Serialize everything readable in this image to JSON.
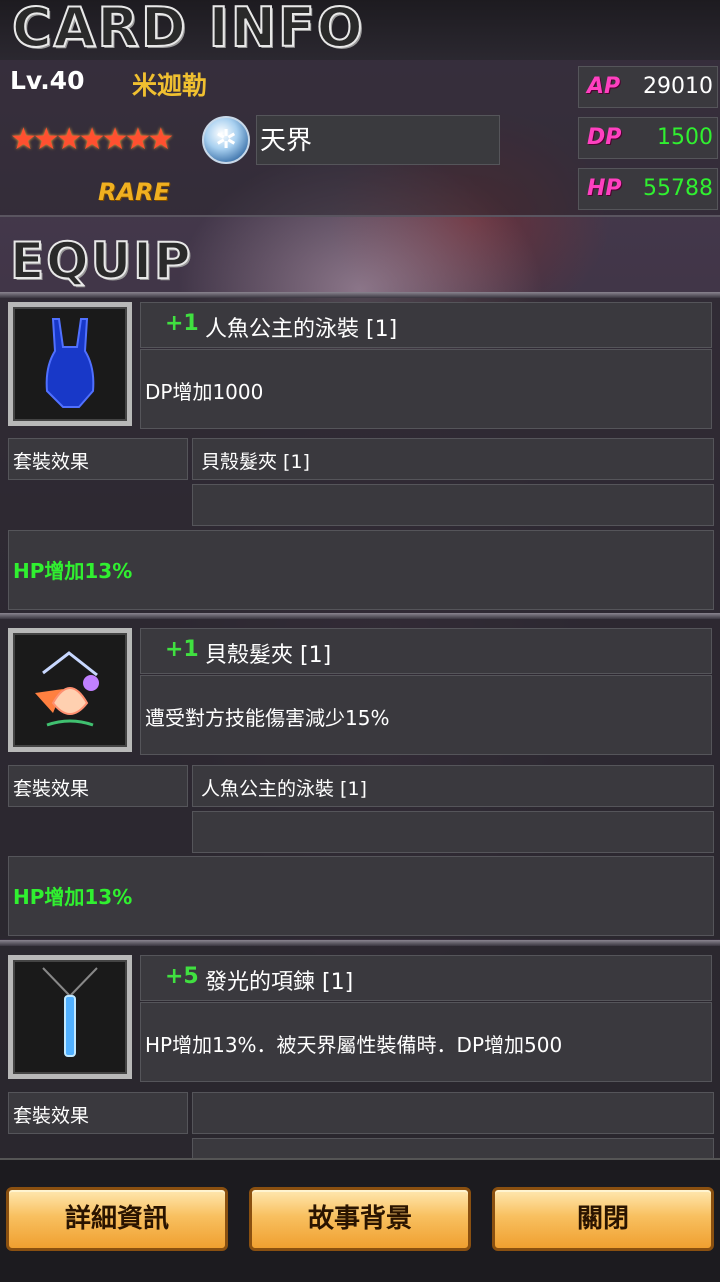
{
  "header": {
    "title": "CARD INFO"
  },
  "card": {
    "level": "Lv.40",
    "name": "米迦勒",
    "stars": "★★★★★★★",
    "element_icon": "snowflake-icon",
    "element": "天界",
    "rarity": "RARE",
    "stats": [
      {
        "label": "AP",
        "value": "29010",
        "color": "#ffffff"
      },
      {
        "label": "DP",
        "value": "1500",
        "color": "#30f030"
      },
      {
        "label": "HP",
        "value": "55788",
        "color": "#30f030"
      }
    ]
  },
  "equip": {
    "title": "EQUIP",
    "set_label": "套裝效果",
    "items": [
      {
        "plus": "+1",
        "name": "人魚公主的泳裝 [1]",
        "icon": "swimsuit-icon",
        "description": "DP增加1000",
        "set_partner": "貝殼髮夾 [1]",
        "set_effect": "HP增加13%"
      },
      {
        "plus": "+1",
        "name": "貝殼髮夾 [1]",
        "icon": "shell-hairpin-icon",
        "description": "遭受對方技能傷害減少15%",
        "set_partner": "人魚公主的泳裝 [1]",
        "set_effect": "HP增加13%"
      },
      {
        "plus": "+5",
        "name": "發光的項鍊 [1]",
        "icon": "glowing-necklace-icon",
        "description": "HP增加13%．被天界屬性裝備時．DP增加500"
      }
    ]
  },
  "footer": {
    "buttons": [
      "詳細資訊",
      "故事背景",
      "關閉"
    ]
  },
  "colors": {
    "accent_gold": "#f0c030",
    "stat_pink": "#ff40c0",
    "bonus_green": "#30f030"
  }
}
